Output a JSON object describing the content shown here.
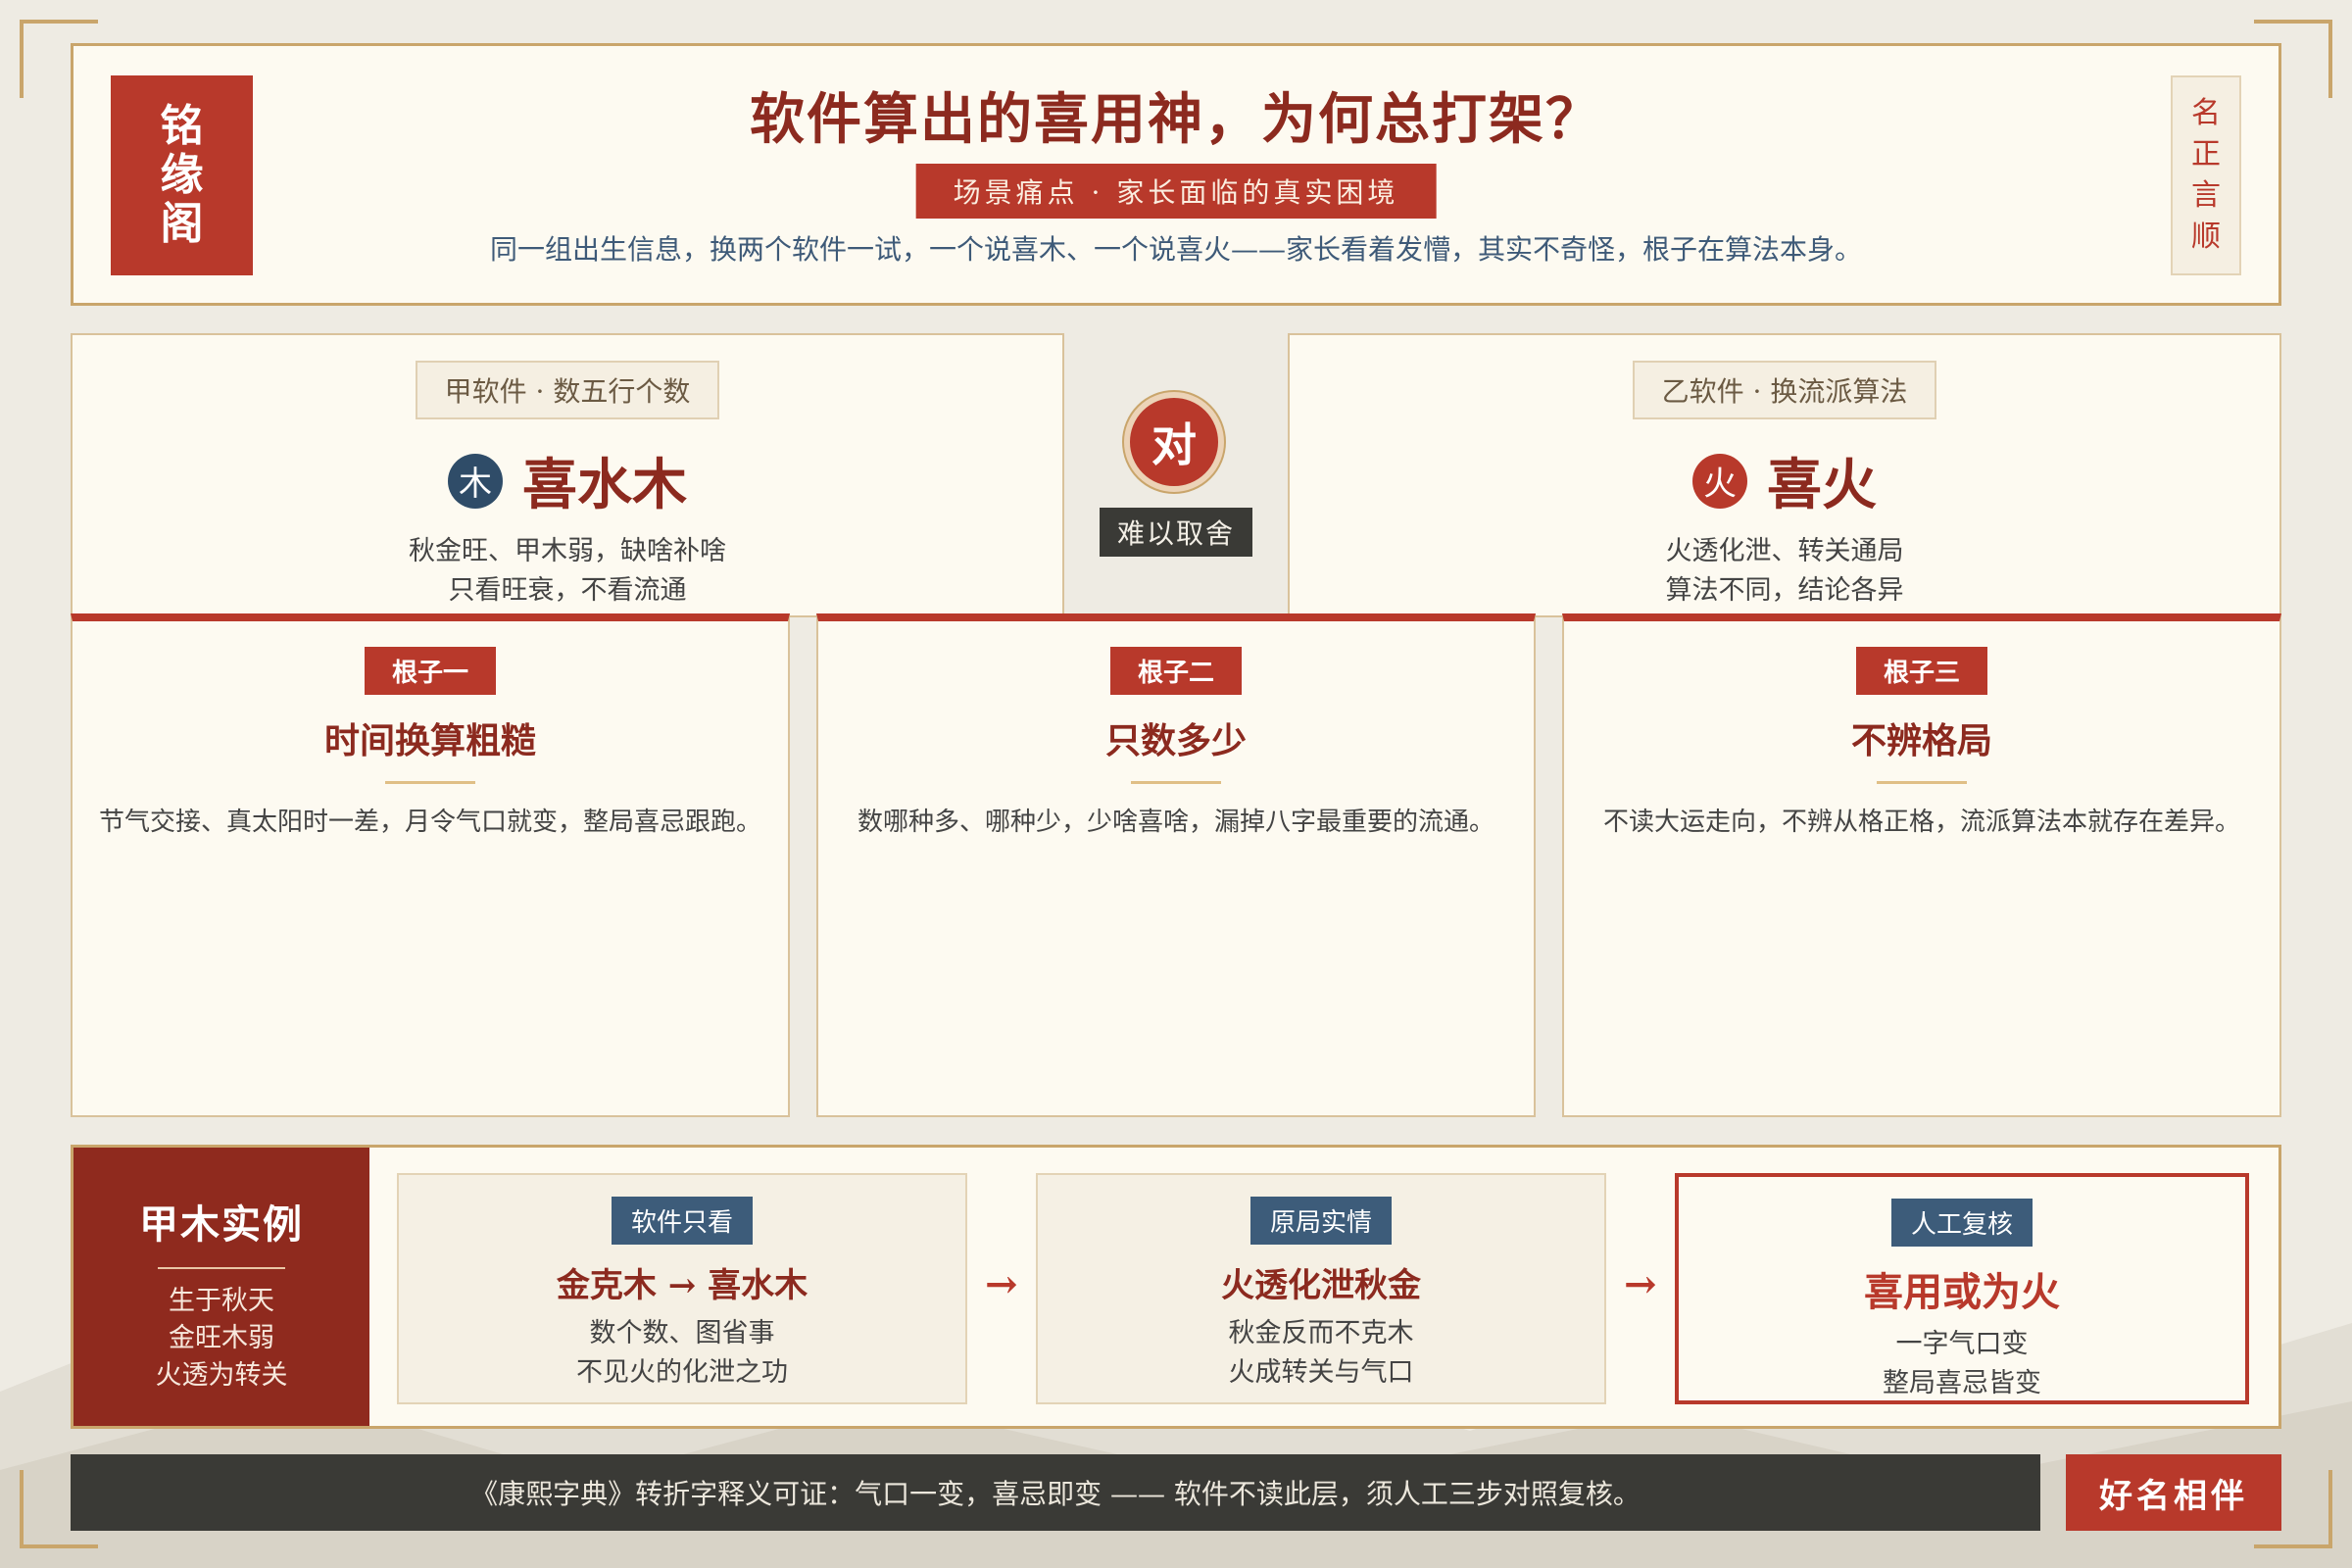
{
  "brand": {
    "logo_chars": [
      "铭",
      "缘",
      "阁"
    ],
    "seal_chars": [
      "名",
      "正",
      "言",
      "顺"
    ],
    "footer_brand": "好名相伴"
  },
  "header": {
    "title": "软件算出的喜用神，为何总打架？",
    "subtitle_tag": "场景痛点 · 家长面临的真实困境",
    "description": "同一组出生信息，换两个软件一试，一个说喜木、一个说喜火——家长看着发懵，其实不奇怪，根子在算法本身。"
  },
  "compare": {
    "software_a": {
      "tag": "甲软件 · 数五行个数",
      "element": "木",
      "verdict": "喜水木",
      "lines": [
        "秋金旺、甲木弱，缺啥补啥",
        "只看旺衰，不看流通"
      ]
    },
    "vs": {
      "symbol": "对",
      "label": "难以取舍"
    },
    "software_b": {
      "tag": "乙软件 · 换流派算法",
      "element": "火",
      "verdict": "喜火",
      "lines": [
        "火透化泄、转关通局",
        "算法不同，结论各异"
      ]
    }
  },
  "roots": [
    {
      "tag": "根子一",
      "title": "时间换算粗糙",
      "text": "节气交接、真太阳时一差，月令气口就变，整局喜忌跟跑。"
    },
    {
      "tag": "根子二",
      "title": "只数多少",
      "text": "数哪种多、哪种少，少啥喜啥，漏掉八字最重要的流通。"
    },
    {
      "tag": "根子三",
      "title": "不辨格局",
      "text": "不读大运走向，不辨从格正格，流派算法本就存在差异。"
    }
  ],
  "example": {
    "title": "甲木实例",
    "lines": [
      "生于秋天",
      "金旺木弱",
      "火透为转关"
    ],
    "arrow": "→",
    "steps": [
      {
        "tag": "软件只看",
        "title": "金克木 → 喜水木",
        "lines": [
          "数个数、图省事",
          "不见火的化泄之功"
        ]
      },
      {
        "tag": "原局实情",
        "title": "火透化泄秋金",
        "lines": [
          "秋金反而不克木",
          "火成转关与气口"
        ]
      },
      {
        "tag": "人工复核",
        "title": "喜用或为火",
        "lines": [
          "一字气口变",
          "整局喜忌皆变"
        ]
      }
    ]
  },
  "footer": {
    "text": "《康熙字典》转折字释义可证：气口一变，喜忌即变 —— 软件不读此层，须人工三步对照复核。"
  },
  "colors": {
    "accent_red": "#b8392b",
    "dark_red": "#8c2a1f",
    "gold": "#c9a56b",
    "navy": "#2f4c68",
    "charcoal": "#3a3a36",
    "paper": "#fdfaf1"
  }
}
